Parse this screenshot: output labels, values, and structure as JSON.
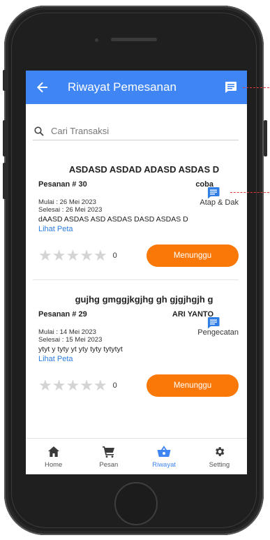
{
  "appbar": {
    "title": "Riwayat Pemesanan",
    "back_icon": "arrow-left-icon",
    "chat_icon": "message-icon"
  },
  "search": {
    "placeholder": "Cari Transaksi",
    "icon": "search-icon"
  },
  "orders": [
    {
      "title": "ASDASD ASDAD ADASD ASDAS D",
      "order_no": "Pesanan # 30",
      "customer": "coba",
      "start": "Mulai : 26 Mei 2023",
      "end": "Selesai : 26 Mei 2023",
      "category": "Atap & Dak",
      "description": "dAASD ASDAS ASD ASDAS DASD ASDAS D",
      "map_link": "Lihat Peta",
      "rating_count": "0",
      "status": "Menunggu"
    },
    {
      "title": "gujhg gmggjkgjhg gh gjgjhgjh g",
      "order_no": "Pesanan # 29",
      "customer": "ARI YANTO",
      "start": "Mulai : 14 Mei 2023",
      "end": "Selesai : 15 Mei 2023",
      "category": "Pengecatan",
      "description": "ytyt y tyty yt yty tyty tytytyt",
      "map_link": "Lihat Peta",
      "rating_count": "0",
      "status": "Menunggu"
    }
  ],
  "nav": {
    "items": [
      {
        "label": "Home",
        "icon": "home-icon"
      },
      {
        "label": "Pesan",
        "icon": "cart-icon"
      },
      {
        "label": "Riwayat",
        "icon": "basket-icon"
      },
      {
        "label": "Setting",
        "icon": "gear-icon"
      }
    ],
    "active": "Riwayat"
  },
  "colors": {
    "primary": "#3f86f4",
    "status_button": "#f97808",
    "link": "#2a7de1"
  }
}
